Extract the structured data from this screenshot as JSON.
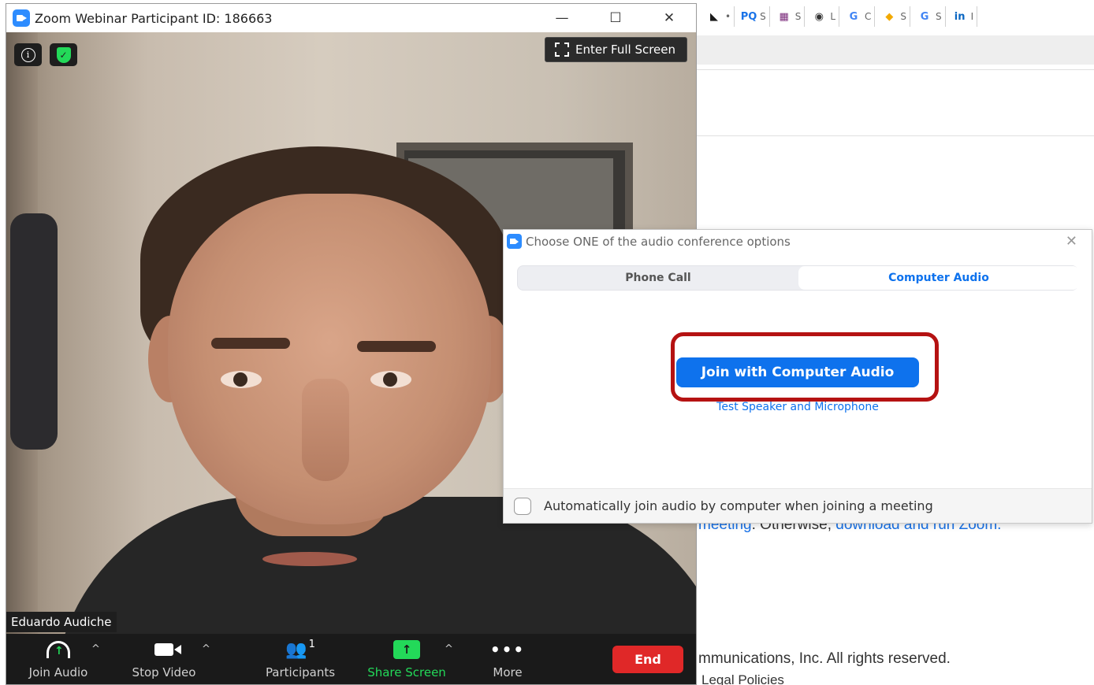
{
  "zoom_window": {
    "title": "Zoom Webinar Participant ID: 186663",
    "controls": {
      "minimize": "—",
      "maximize": "☐",
      "close": "✕"
    },
    "enter_full_screen": "Enter Full Screen",
    "participant_name": "Eduardo Audiche",
    "toolbar": {
      "join_audio": "Join Audio",
      "stop_video": "Stop Video",
      "participants": "Participants",
      "participants_count": "1",
      "share_screen": "Share Screen",
      "more": "More",
      "end": "End"
    }
  },
  "audio_dialog": {
    "title": "Choose ONE of the audio conference options",
    "tabs": [
      "Phone Call",
      "Computer Audio"
    ],
    "active_tab": "Computer Audio",
    "join_button": "Join with Computer Audio",
    "test_link": "Test Speaker and Microphone",
    "auto_join_label": "Automatically join audio by computer when joining a meeting",
    "auto_join_checked": false
  },
  "background_page": {
    "bookmarks": [
      {
        "glyph": "◣",
        "label": "•",
        "color": "#1a1a1a"
      },
      {
        "glyph": "PQ",
        "label": "S",
        "color": "#1a73e8"
      },
      {
        "glyph": "▦",
        "label": "S",
        "color": "#7a2a7a"
      },
      {
        "glyph": "◉",
        "label": "L",
        "color": "#333333"
      },
      {
        "glyph": "G",
        "label": "C",
        "color": "#4285f4"
      },
      {
        "glyph": "◆",
        "label": "S",
        "color": "#f2a900"
      },
      {
        "glyph": "G",
        "label": "S",
        "color": "#4285f4"
      },
      {
        "glyph": "in",
        "label": "I",
        "color": "#0a66c2"
      }
    ],
    "text_line_1_link1": "meeting",
    "text_line_1_plain": ". Otherwise, ",
    "text_line_1_link2": "download and run Zoom.",
    "copyright": "mmunications, Inc. All rights reserved.",
    "legal": "Legal Policies"
  },
  "colors": {
    "zoom_blue": "#0e72ed",
    "zoom_green": "#23d959",
    "end_red": "#e02828",
    "highlight_red": "#b51212"
  }
}
